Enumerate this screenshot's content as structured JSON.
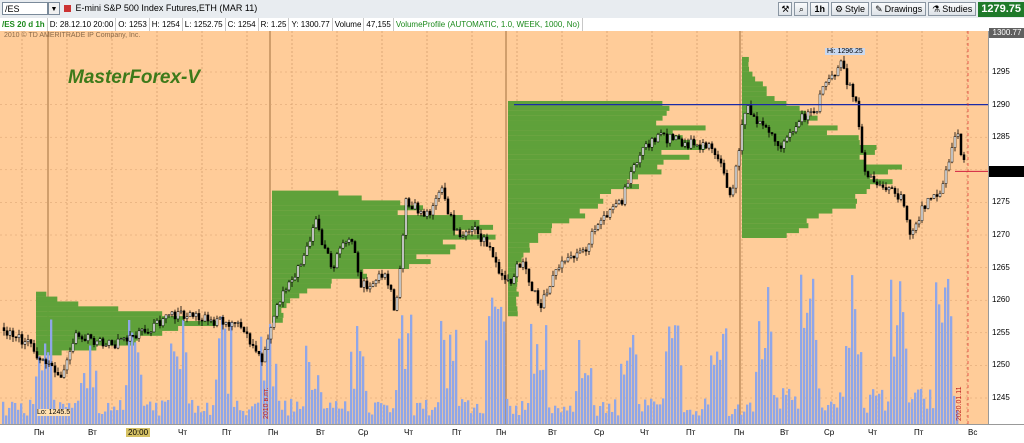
{
  "toolbar": {
    "symbol": "/ES",
    "description": "E-mini S&P 500 Index Futures,ETH (MAR 11)",
    "interval": "1h",
    "style_label": "Style",
    "drawings_label": "Drawings",
    "studies_label": "Studies",
    "last_price": "1279.75"
  },
  "infobar": {
    "chart_name": "/ES 20 d 1h",
    "date": "D: 28.12.10 20:00",
    "open": "O: 1253",
    "high": "H: 1254",
    "low": "L: 1252.75",
    "close": "C: 1254",
    "range": "R: 1.25",
    "y": "Y: 1300.77",
    "volume_label": "Volume",
    "volume_value": "47,155",
    "study": "VolumeProfile (AUTOMATIC, 1.0, WEEK, 1000, No)"
  },
  "chart": {
    "copyright": "2010 © TD AMERITRADE IP Company, Inc.",
    "watermark": "MasterForex-V",
    "hi_label": "Hi: 1296.25",
    "lo_label": "Lo: 1245.5",
    "date_marker_1": "2010 в.пт.",
    "date_marker_2": "2020.01.11",
    "colors": {
      "background": "#ffcc99",
      "profile": "#5fa13a",
      "volume": "#8fa6e8",
      "candle": "#000000",
      "hline": "#1a2aa8"
    }
  },
  "yaxis": {
    "cursor_value": "1300.77",
    "ticks": [
      "1295",
      "1290",
      "1285",
      "1280",
      "1275",
      "1270",
      "1265",
      "1260",
      "1255",
      "1250",
      "1245"
    ],
    "current_price": "1279.75"
  },
  "xaxis": {
    "labels": [
      "Пн",
      "Вт",
      "20:00",
      "Чт",
      "Пт",
      "Пн",
      "Вт",
      "Ср",
      "Чт",
      "Пт",
      "Пн",
      "Вт",
      "Ср",
      "Чт",
      "Пт",
      "Пн",
      "Вт",
      "Ср",
      "Чт",
      "Пт",
      "Вс"
    ]
  }
}
